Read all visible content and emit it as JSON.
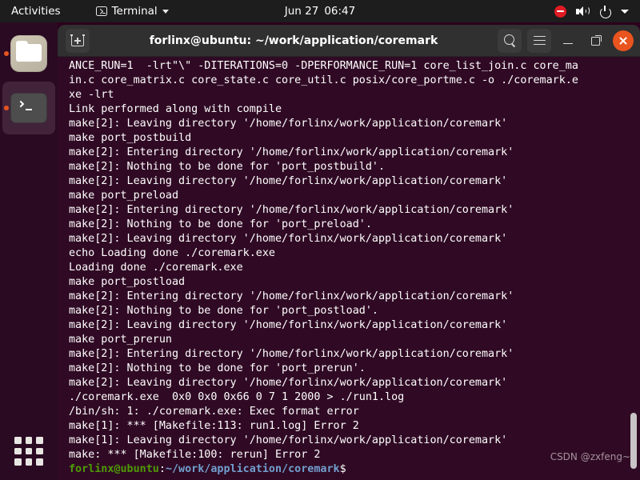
{
  "topbar": {
    "activities": "Activities",
    "app_name": "Terminal",
    "date": "Jun 27",
    "time": "06:47",
    "icons": {
      "app_icon": "terminal-icon",
      "menu_caret": "chevron-down-icon",
      "dnd": "do-not-disturb-icon",
      "volume": "volume-icon",
      "power": "power-icon",
      "tray_caret": "chevron-down-icon"
    }
  },
  "dock": {
    "items": [
      {
        "name": "files",
        "label": "Files",
        "icon": "folder-icon",
        "running": true
      },
      {
        "name": "terminal",
        "label": "Terminal",
        "icon": "terminal-icon",
        "running": true,
        "focused": true
      }
    ],
    "show_applications": "show-applications-grid-icon"
  },
  "window": {
    "title": "forlinx@ubuntu: ~/work/application/coremark",
    "buttons": {
      "new_tab": "new-tab-icon",
      "search": "search-icon",
      "menu": "hamburger-menu-icon",
      "minimize": "minimize-icon",
      "maximize": "restore-icon",
      "close": "close-icon"
    }
  },
  "terminal": {
    "background_color": "#300a24",
    "foreground_color": "#ffffff",
    "prompt_user_color": "#4e9a06",
    "prompt_path_color": "#729fcf",
    "lines": [
      "ANCE_RUN=1  -lrt\"\\\" -DITERATIONS=0 -DPERFORMANCE_RUN=1 core_list_join.c core_ma",
      "in.c core_matrix.c core_state.c core_util.c posix/core_portme.c -o ./coremark.e",
      "xe -lrt",
      "Link performed along with compile",
      "make[2]: Leaving directory '/home/forlinx/work/application/coremark'",
      "make port_postbuild",
      "make[2]: Entering directory '/home/forlinx/work/application/coremark'",
      "make[2]: Nothing to be done for 'port_postbuild'.",
      "make[2]: Leaving directory '/home/forlinx/work/application/coremark'",
      "make port_preload",
      "make[2]: Entering directory '/home/forlinx/work/application/coremark'",
      "make[2]: Nothing to be done for 'port_preload'.",
      "make[2]: Leaving directory '/home/forlinx/work/application/coremark'",
      "echo Loading done ./coremark.exe",
      "Loading done ./coremark.exe",
      "make port_postload",
      "make[2]: Entering directory '/home/forlinx/work/application/coremark'",
      "make[2]: Nothing to be done for 'port_postload'.",
      "make[2]: Leaving directory '/home/forlinx/work/application/coremark'",
      "make port_prerun",
      "make[2]: Entering directory '/home/forlinx/work/application/coremark'",
      "make[2]: Nothing to be done for 'port_prerun'.",
      "make[2]: Leaving directory '/home/forlinx/work/application/coremark'",
      "./coremark.exe  0x0 0x0 0x66 0 7 1 2000 > ./run1.log",
      "/bin/sh: 1: ./coremark.exe: Exec format error",
      "make[1]: *** [Makefile:113: run1.log] Error 2",
      "make[1]: Leaving directory '/home/forlinx/work/application/coremark'",
      "make: *** [Makefile:100: rerun] Error 2"
    ],
    "prompt": {
      "user_host": "forlinx@ubuntu",
      "separator": ":",
      "path": "~/work/application/coremark",
      "symbol": "$"
    }
  },
  "watermark": "CSDN @zxfeng~"
}
